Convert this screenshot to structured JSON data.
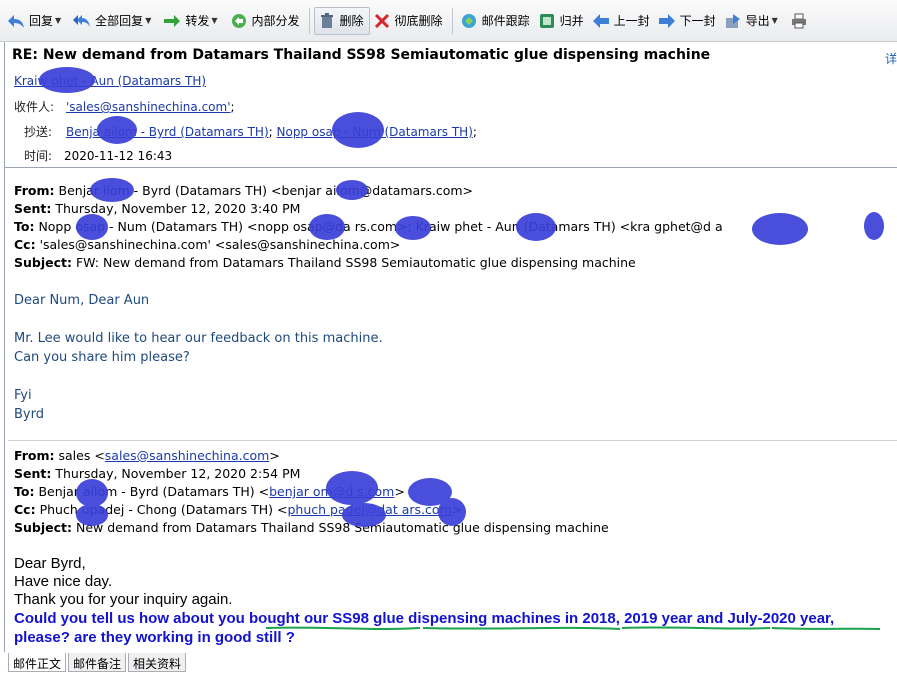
{
  "toolbar": {
    "reply": "回复",
    "reply_all": "全部回复",
    "forward": "转发",
    "internal_forward": "内部分发",
    "delete": "删除",
    "delete_permanently": "彻底删除",
    "track": "邮件跟踪",
    "merge": "归并",
    "prev": "上一封",
    "next": "下一封",
    "export": "导出"
  },
  "header": {
    "subject": "RE: New demand from Datamars Thailand SS98 Semiautomatic glue dispensing machine",
    "detail_link": "详",
    "sender": "Kraiw phet - Aun (Datamars TH)",
    "to_label": "收件人:",
    "to_value": "'sales@sanshinechina.com'",
    "cc_label": "抄送:",
    "cc_1": "Benja ailom - Byrd (Datamars TH)",
    "cc_2": "Nopp osap - Num (Datamars TH)",
    "time_label": "时间:",
    "time_value": "2020-11-12 16:43"
  },
  "msg1": {
    "from_label": "From:",
    "from": "Benjar ilom - Byrd (Datamars TH) <benjar ailom@datamars.com>",
    "sent_label": "Sent:",
    "sent": "Thursday, November 12, 2020 3:40 PM",
    "to_label": "To:",
    "to": "Nopp osap - Num (Datamars TH) <nopp osap@da rs.com>; Kraiw phet - Aun (Datamars TH) <kra gphet@d a",
    "cc_label": "Cc:",
    "cc": "'sales@sanshinechina.com' <sales@sanshinechina.com>",
    "subject_label": "Subject:",
    "subject": "FW: New demand from Datamars Thailand SS98 Semiautomatic glue dispensing machine",
    "greeting": "Dear Num, Dear Aun",
    "line1": "Mr. Lee would like to hear our feedback on this machine.",
    "line2": "Can you share him please?",
    "sig1": "Fyi",
    "sig2": "Byrd"
  },
  "msg2": {
    "from_label": "From:",
    "from_name": "sales <",
    "from_email": "sales@sanshinechina.com",
    "from_tail": ">",
    "sent_label": "Sent:",
    "sent": "Thursday, November 12, 2020 2:54 PM",
    "to_label": "To:",
    "to_name": "Benjar ailom - Byrd (Datamars TH) <",
    "to_email": "benjar om@d s.com",
    "to_tail": ">",
    "cc_label": "Cc:",
    "cc_name": "Phuch upadej - Chong (Datamars TH) <",
    "cc_email": "phuch padej@dat ars.com",
    "cc_tail": ">",
    "subject_label": "Subject:",
    "subject": "New demand from Datamars Thailand SS98 Semiautomatic glue dispensing machine",
    "greeting": "Dear Byrd,",
    "line1": "Have nice day.",
    "line2": "Thank you for your inquiry again.",
    "question1": "Could you tell us how about you bought our SS98 glue dispensing machines in 2018, 2019 year and July-2020 year,",
    "question2": "please? are they working in good still ?"
  },
  "tabs": [
    "邮件正文",
    "邮件备注",
    "相关资料"
  ],
  "colors": {
    "link": "#1c3aa9",
    "quote_blue": "#1f497d",
    "bold_blue": "#1212d0",
    "underline_green": "#1aa34a",
    "scribble": "#3a3fd8"
  }
}
